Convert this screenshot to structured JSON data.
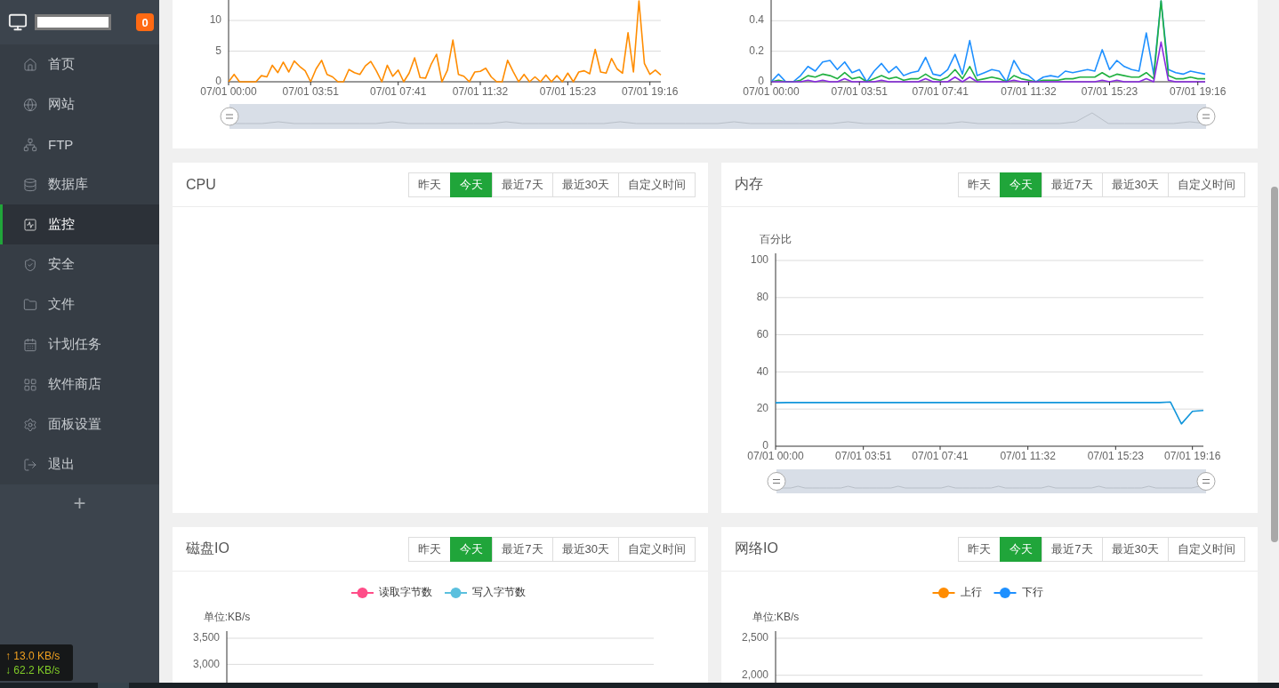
{
  "sidebar": {
    "badge": "0",
    "items": [
      {
        "label": "首页",
        "selected": false
      },
      {
        "label": "网站",
        "selected": false
      },
      {
        "label": "FTP",
        "selected": false
      },
      {
        "label": "数据库",
        "selected": false
      },
      {
        "label": "监控",
        "selected": true
      },
      {
        "label": "安全",
        "selected": false
      },
      {
        "label": "文件",
        "selected": false
      },
      {
        "label": "计划任务",
        "selected": false
      },
      {
        "label": "软件商店",
        "selected": false
      },
      {
        "label": "面板设置",
        "selected": false
      },
      {
        "label": "退出",
        "selected": false
      }
    ],
    "add_button": "+"
  },
  "net_speed": {
    "up": "↑ 13.0 KB/s",
    "down": "↓ 62.2 KB/s"
  },
  "top_panel": {
    "charts": [
      {
        "chart_data": {
          "type": "line",
          "grid": true,
          "ylim": [
            0,
            13.2
          ],
          "yticks": [
            0,
            5,
            10
          ],
          "categories": [
            "07/01 00:00",
            null,
            null,
            null,
            null,
            null,
            null,
            null,
            null,
            null,
            null,
            null,
            null,
            null,
            null,
            "07/01 03:51",
            null,
            null,
            null,
            null,
            null,
            null,
            null,
            null,
            null,
            null,
            null,
            null,
            null,
            null,
            null,
            "07/01 07:41",
            null,
            null,
            null,
            null,
            null,
            null,
            null,
            null,
            null,
            null,
            null,
            null,
            null,
            null,
            "07/01 11:32",
            null,
            null,
            null,
            null,
            null,
            null,
            null,
            null,
            null,
            null,
            null,
            null,
            null,
            null,
            null,
            "07/01 15:23",
            null,
            null,
            null,
            null,
            null,
            null,
            null,
            null,
            null,
            null,
            null,
            null,
            null,
            null,
            "07/01 19:16",
            null,
            null
          ],
          "series": [
            {
              "color": "#ff8c00",
              "values": [
                0,
                1.2,
                0,
                0,
                0,
                0,
                1,
                0.8,
                2.7,
                1.5,
                3.2,
                1.6,
                3.4,
                2.5,
                1.8,
                0,
                2.1,
                3.5,
                1.2,
                0.8,
                0,
                0,
                2,
                1.5,
                1.2,
                2.6,
                3.3,
                1.8,
                0,
                2.7,
                0.9,
                1.9,
                0,
                1.4,
                3.9,
                0.7,
                0.6,
                2.8,
                4.5,
                0,
                1.9,
                6.8,
                1.2,
                0.9,
                0,
                1.6,
                1.7,
                2.2,
                0.8,
                0,
                0,
                3.5,
                1.7,
                0,
                1.2,
                0,
                0.8,
                0,
                1.1,
                0,
                1,
                0,
                1.4,
                0,
                1.6,
                1.8,
                1.3,
                5.3,
                1.6,
                1.4,
                3.8,
                2.1,
                1.4,
                8,
                1.6,
                13.2,
                3,
                1.2,
                1.9,
                1.1
              ]
            }
          ]
        }
      },
      {
        "chart_data": {
          "type": "line",
          "grid": true,
          "ylim": [
            0,
            0.53
          ],
          "yticks": [
            0,
            0.2,
            0.4
          ],
          "categories": [
            "07/01 00:00",
            null,
            null,
            null,
            null,
            null,
            null,
            null,
            null,
            null,
            null,
            null,
            "07/01 03:51",
            null,
            null,
            null,
            null,
            null,
            null,
            null,
            null,
            null,
            null,
            "07/01 07:41",
            null,
            null,
            null,
            null,
            null,
            null,
            null,
            null,
            null,
            null,
            null,
            "07/01 11:32",
            null,
            null,
            null,
            null,
            null,
            null,
            null,
            null,
            null,
            null,
            "07/01 15:23",
            null,
            null,
            null,
            null,
            null,
            null,
            null,
            null,
            null,
            null,
            null,
            "07/01 19:16",
            null
          ],
          "series": [
            {
              "color": "#1e90ff",
              "values": [
                0,
                0.05,
                0,
                0,
                0.04,
                0.1,
                0.07,
                0.13,
                0.14,
                0.08,
                0.13,
                0.06,
                0.08,
                0,
                0.07,
                0.12,
                0.06,
                0.1,
                0.04,
                0.06,
                0.07,
                0.16,
                0.05,
                0.04,
                0.08,
                0.18,
                0.05,
                0.27,
                0.04,
                0.06,
                0.08,
                0.07,
                0,
                0.14,
                0.06,
                0.04,
                0,
                0.03,
                0.04,
                0.03,
                0.07,
                0.06,
                0.07,
                0.08,
                0.07,
                0.21,
                0.08,
                0.14,
                0.1,
                0.08,
                0.07,
                0.32,
                0.05,
                0.53,
                0.08,
                0.06,
                0.05,
                0.07,
                0.06,
                0.05
              ]
            },
            {
              "color": "#20b040",
              "values": [
                0,
                0.01,
                0,
                0,
                0.01,
                0.04,
                0.03,
                0.05,
                0.04,
                0.02,
                0.06,
                0.02,
                0.03,
                0,
                0.02,
                0.04,
                0.02,
                0.03,
                0.01,
                0.02,
                0.02,
                0.05,
                0.02,
                0.01,
                0.03,
                0.08,
                0.02,
                0.1,
                0.01,
                0.02,
                0.03,
                0.02,
                0,
                0.04,
                0.02,
                0.01,
                0,
                0.01,
                0.01,
                0.01,
                0.02,
                0.02,
                0.03,
                0.03,
                0.03,
                0.06,
                0.03,
                0.05,
                0.04,
                0.03,
                0.03,
                0.06,
                0.02,
                0.53,
                0.04,
                0.02,
                0.02,
                0.03,
                0.02,
                0.02
              ]
            },
            {
              "color": "#8a2be2",
              "values": [
                0,
                0,
                0,
                0,
                0,
                0.01,
                0,
                0.01,
                0,
                0,
                0.02,
                0,
                0,
                0,
                0,
                0.01,
                0,
                0,
                0,
                0,
                0,
                0.02,
                0,
                0,
                0,
                0.03,
                0,
                0.03,
                0,
                0,
                0,
                0,
                0,
                0.01,
                0,
                0,
                0,
                0,
                0,
                0,
                0,
                0,
                0,
                0,
                0,
                0.01,
                0,
                0.01,
                0,
                0,
                0,
                0.02,
                0,
                0.26,
                0.01,
                0,
                0,
                0,
                0,
                0
              ]
            }
          ]
        }
      }
    ]
  },
  "cards": [
    {
      "title": "CPU",
      "range_tabs": [
        {
          "label": "昨天",
          "selected": false
        },
        {
          "label": "今天",
          "selected": true
        },
        {
          "label": "最近7天",
          "selected": false
        },
        {
          "label": "最近30天",
          "selected": false
        },
        {
          "label": "自定义时间",
          "selected": false
        }
      ]
    },
    {
      "title": "内存",
      "range_tabs": [
        {
          "label": "昨天",
          "selected": false
        },
        {
          "label": "今天",
          "selected": true
        },
        {
          "label": "最近7天",
          "selected": false
        },
        {
          "label": "最近30天",
          "selected": false
        },
        {
          "label": "自定义时间",
          "selected": false
        }
      ],
      "chart_data": {
        "type": "line",
        "grid": true,
        "ylabel": "百分比",
        "ylim": [
          0,
          100
        ],
        "yticks": [
          0,
          20,
          40,
          60,
          80,
          100
        ],
        "categories": [
          "07/01 00:00",
          null,
          null,
          null,
          null,
          null,
          null,
          null,
          "07/01 03:51",
          null,
          null,
          null,
          null,
          null,
          null,
          "07/01 07:41",
          null,
          null,
          null,
          null,
          null,
          null,
          null,
          "07/01 11:32",
          null,
          null,
          null,
          null,
          null,
          null,
          null,
          "07/01 15:23",
          null,
          null,
          null,
          null,
          null,
          null,
          "07/01 19:16",
          null
        ],
        "series": [
          {
            "color": "#1296db",
            "values": [
              23.4,
              23.5,
              23.5,
              23.5,
              23.5,
              23.5,
              23.5,
              23.5,
              23.5,
              23.5,
              23.5,
              23.5,
              23.5,
              23.6,
              23.5,
              23.5,
              23.5,
              23.5,
              23.5,
              23.5,
              23.5,
              23.5,
              23.5,
              23.5,
              23.5,
              23.5,
              23.5,
              23.5,
              23.5,
              23.5,
              23.5,
              23.5,
              23.5,
              23.5,
              23.5,
              23.5,
              23.8,
              12,
              18.8,
              19.3
            ]
          }
        ]
      }
    },
    {
      "title": "磁盘IO",
      "range_tabs": [
        {
          "label": "昨天",
          "selected": false
        },
        {
          "label": "今天",
          "selected": true
        },
        {
          "label": "最近7天",
          "selected": false
        },
        {
          "label": "最近30天",
          "selected": false
        },
        {
          "label": "自定义时间",
          "selected": false
        }
      ],
      "chart_data": {
        "type": "line",
        "grid": true,
        "ylabel": "单位:KB/s",
        "ylim": [
          2650,
          3500
        ],
        "yticks": [
          {
            "value": 3000,
            "label": "3,000"
          },
          {
            "value": 3500,
            "label": "3,500"
          }
        ],
        "series": [
          {
            "name": "读取字节数",
            "color": "#ff4d88"
          },
          {
            "name": "写入字节数",
            "color": "#5bc0de"
          }
        ]
      }
    },
    {
      "title": "网络IO",
      "range_tabs": [
        {
          "label": "昨天",
          "selected": false
        },
        {
          "label": "今天",
          "selected": true
        },
        {
          "label": "最近7天",
          "selected": false
        },
        {
          "label": "最近30天",
          "selected": false
        },
        {
          "label": "自定义时间",
          "selected": false
        }
      ],
      "chart_data": {
        "type": "line",
        "grid": true,
        "ylabel": "单位:KB/s",
        "ylim": [
          1900,
          2500
        ],
        "yticks": [
          {
            "value": 2000,
            "label": "2,000"
          },
          {
            "value": 2500,
            "label": "2,500"
          }
        ],
        "series": [
          {
            "name": "上行",
            "color": "#ff8c00"
          },
          {
            "name": "下行",
            "color": "#1e90ff"
          }
        ]
      }
    }
  ]
}
